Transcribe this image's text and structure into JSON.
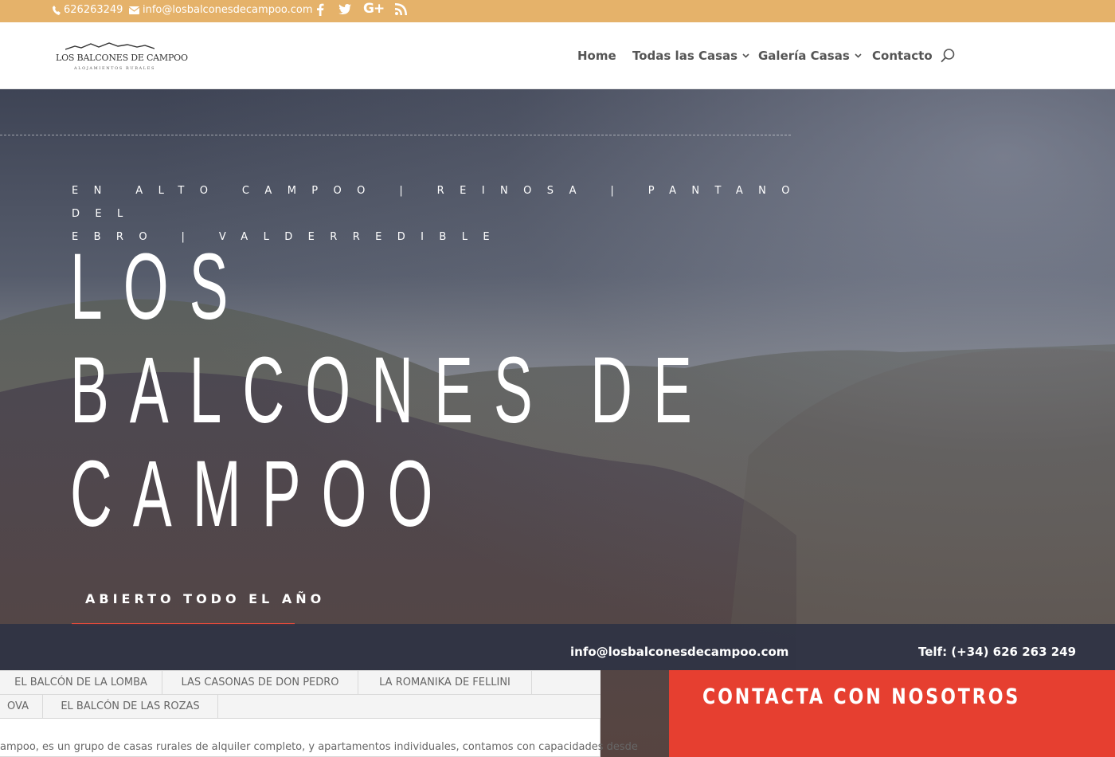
{
  "topbar": {
    "phone": "626263249",
    "email": "info@losbalconesdecampoo.com",
    "social": [
      "facebook-icon",
      "twitter-icon",
      "google-plus-icon",
      "rss-icon"
    ]
  },
  "logo": {
    "main": "LOS BALCONES DE CAMPOO",
    "sub": "ALOJAMIENTOS RURALES"
  },
  "nav": {
    "items": [
      {
        "label": "Home",
        "has_dropdown": false
      },
      {
        "label": "Todas las Casas",
        "has_dropdown": true
      },
      {
        "label": "Galería Casas",
        "has_dropdown": true
      },
      {
        "label": "Contacto",
        "has_dropdown": false
      }
    ]
  },
  "hero": {
    "subtitle_line1": "EN ALTO CAMPOO | REINOSA | PANTANO DEL",
    "subtitle_line2": "EBRO | VALDERREDIBLE",
    "title_line1": "LOS",
    "title_line2": "BALCONES DE",
    "title_line3": "CAMPOO",
    "open_label": "ABIERTO TODO EL AÑO",
    "contact_email": "info@losbalconesdecampoo.com",
    "contact_phone": "Telf: (+34) 626 263 249"
  },
  "tabs": {
    "row1": [
      "EL BALCÓN DE LA LOMBA",
      "LAS CASONAS DE DON PEDRO",
      "LA ROMANIKA DE FELLINI"
    ],
    "row2": [
      "OVA",
      "EL BALCÓN DE LAS ROZAS"
    ],
    "description": "ampoo, es un grupo de casas rurales de alquiler completo, y apartamentos individuales, contamos con capacidades desde"
  },
  "contact_box": {
    "heading": "CONTACTA CON NOSOTROS"
  },
  "colors": {
    "topbar": "#e5b26a",
    "accent_red": "#e63f30",
    "hero_overlay": "#343a4c"
  }
}
